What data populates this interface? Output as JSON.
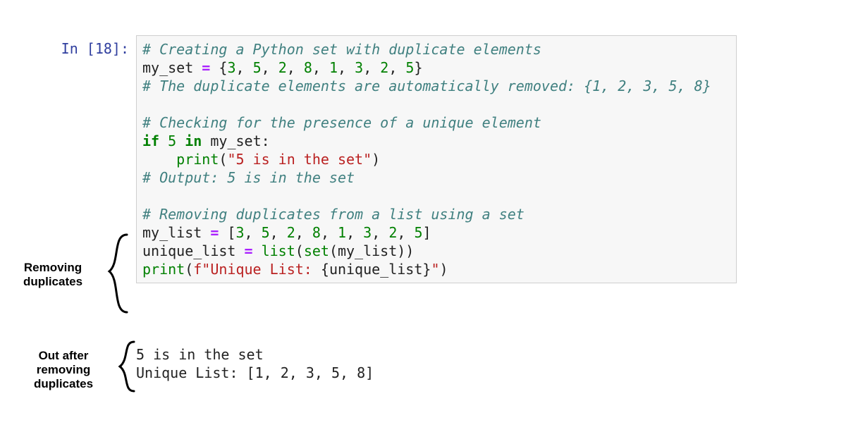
{
  "prompt": {
    "label": "In [18]:"
  },
  "code": {
    "lines": [
      [
        {
          "cls": "tok-comment",
          "text": "# Creating a Python set with duplicate elements"
        }
      ],
      [
        {
          "cls": "tok-default",
          "text": "my_set "
        },
        {
          "cls": "tok-op",
          "text": "="
        },
        {
          "cls": "tok-default",
          "text": " "
        },
        {
          "cls": "tok-brace",
          "text": "{"
        },
        {
          "cls": "tok-num",
          "text": "3"
        },
        {
          "cls": "tok-default",
          "text": ", "
        },
        {
          "cls": "tok-num",
          "text": "5"
        },
        {
          "cls": "tok-default",
          "text": ", "
        },
        {
          "cls": "tok-num",
          "text": "2"
        },
        {
          "cls": "tok-default",
          "text": ", "
        },
        {
          "cls": "tok-num",
          "text": "8"
        },
        {
          "cls": "tok-default",
          "text": ", "
        },
        {
          "cls": "tok-num",
          "text": "1"
        },
        {
          "cls": "tok-default",
          "text": ", "
        },
        {
          "cls": "tok-num",
          "text": "3"
        },
        {
          "cls": "tok-default",
          "text": ", "
        },
        {
          "cls": "tok-num",
          "text": "2"
        },
        {
          "cls": "tok-default",
          "text": ", "
        },
        {
          "cls": "tok-num",
          "text": "5"
        },
        {
          "cls": "tok-brace",
          "text": "}"
        }
      ],
      [
        {
          "cls": "tok-comment",
          "text": "# The duplicate elements are automatically removed: {1, 2, 3, 5, 8}"
        }
      ],
      [
        {
          "cls": "tok-default",
          "text": " "
        }
      ],
      [
        {
          "cls": "tok-comment",
          "text": "# Checking for the presence of a unique element"
        }
      ],
      [
        {
          "cls": "tok-kw",
          "text": "if"
        },
        {
          "cls": "tok-default",
          "text": " "
        },
        {
          "cls": "tok-num",
          "text": "5"
        },
        {
          "cls": "tok-default",
          "text": " "
        },
        {
          "cls": "tok-kw",
          "text": "in"
        },
        {
          "cls": "tok-default",
          "text": " my_set:"
        }
      ],
      [
        {
          "cls": "tok-default",
          "text": "    "
        },
        {
          "cls": "tok-builtin",
          "text": "print"
        },
        {
          "cls": "tok-default",
          "text": "("
        },
        {
          "cls": "tok-str",
          "text": "\"5 is in the set\""
        },
        {
          "cls": "tok-default",
          "text": ")"
        }
      ],
      [
        {
          "cls": "tok-comment",
          "text": "# Output: 5 is in the set"
        }
      ],
      [
        {
          "cls": "tok-default",
          "text": " "
        }
      ],
      [
        {
          "cls": "tok-comment",
          "text": "# Removing duplicates from a list using a set"
        }
      ],
      [
        {
          "cls": "tok-default",
          "text": "my_list "
        },
        {
          "cls": "tok-op",
          "text": "="
        },
        {
          "cls": "tok-default",
          "text": " ["
        },
        {
          "cls": "tok-num",
          "text": "3"
        },
        {
          "cls": "tok-default",
          "text": ", "
        },
        {
          "cls": "tok-num",
          "text": "5"
        },
        {
          "cls": "tok-default",
          "text": ", "
        },
        {
          "cls": "tok-num",
          "text": "2"
        },
        {
          "cls": "tok-default",
          "text": ", "
        },
        {
          "cls": "tok-num",
          "text": "8"
        },
        {
          "cls": "tok-default",
          "text": ", "
        },
        {
          "cls": "tok-num",
          "text": "1"
        },
        {
          "cls": "tok-default",
          "text": ", "
        },
        {
          "cls": "tok-num",
          "text": "3"
        },
        {
          "cls": "tok-default",
          "text": ", "
        },
        {
          "cls": "tok-num",
          "text": "2"
        },
        {
          "cls": "tok-default",
          "text": ", "
        },
        {
          "cls": "tok-num",
          "text": "5"
        },
        {
          "cls": "tok-default",
          "text": "]"
        }
      ],
      [
        {
          "cls": "tok-default",
          "text": "unique_list "
        },
        {
          "cls": "tok-op",
          "text": "="
        },
        {
          "cls": "tok-default",
          "text": " "
        },
        {
          "cls": "tok-builtin",
          "text": "list"
        },
        {
          "cls": "tok-default",
          "text": "("
        },
        {
          "cls": "tok-builtin",
          "text": "set"
        },
        {
          "cls": "tok-default",
          "text": "(my_list))"
        }
      ],
      [
        {
          "cls": "tok-builtin",
          "text": "print"
        },
        {
          "cls": "tok-default",
          "text": "("
        },
        {
          "cls": "tok-str",
          "text": "f\"Unique List: "
        },
        {
          "cls": "tok-default",
          "text": "{"
        },
        {
          "cls": "tok-default",
          "text": "unique_list"
        },
        {
          "cls": "tok-default",
          "text": "}"
        },
        {
          "cls": "tok-str",
          "text": "\""
        },
        {
          "cls": "tok-default",
          "text": ")"
        }
      ]
    ]
  },
  "output": {
    "lines": [
      "5 is in the set",
      "Unique List: [1, 2, 3, 5, 8]"
    ]
  },
  "annotations": {
    "removing_label": "Removing\nduplicates",
    "out_label": "Out after\nremoving\nduplicates"
  }
}
